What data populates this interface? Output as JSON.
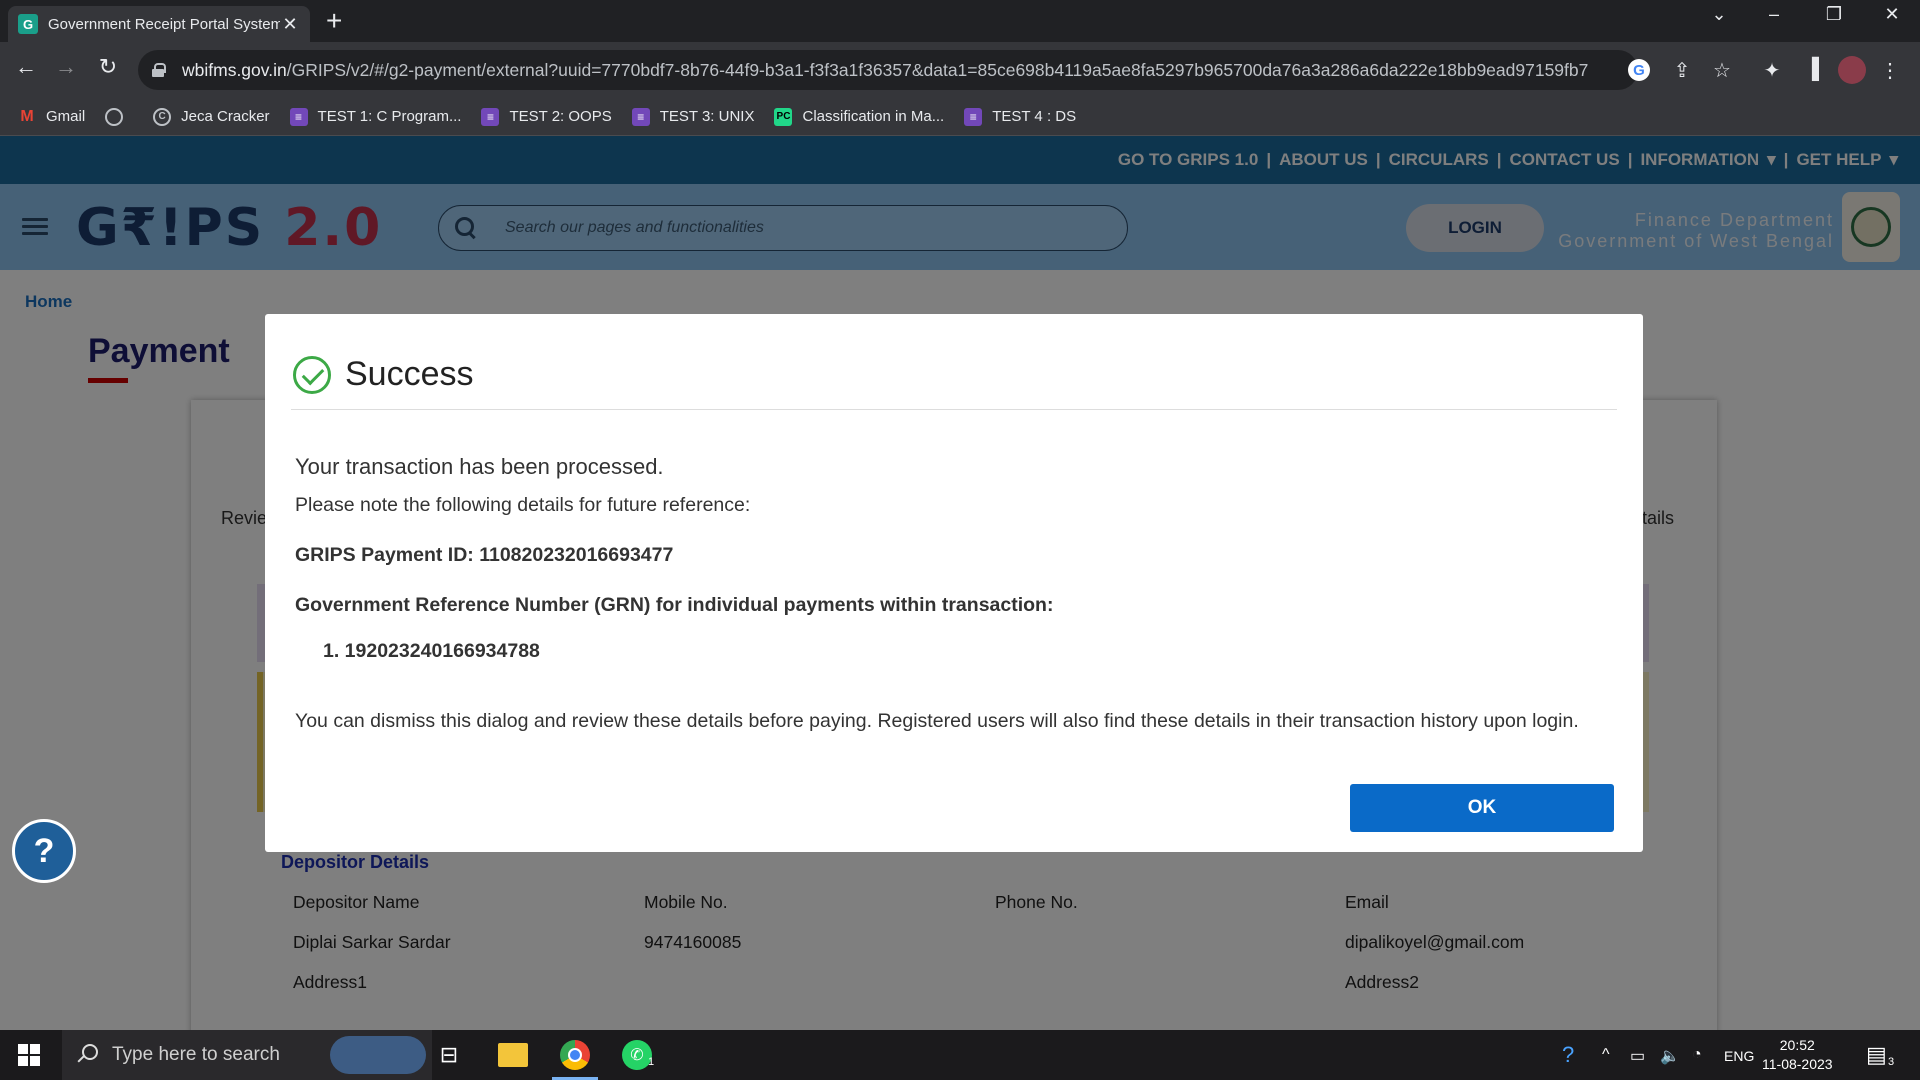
{
  "browser": {
    "tab_title": "Government Receipt Portal System",
    "tab_favicon": "G",
    "url_host": "wbifms.gov.in",
    "url_path": "/GRIPS/v2/#/g2-payment/external?uuid=7770bdf7-8b76-44f9-b3a1-f3f3a1f36357&data1=85ce698b4119a5ae8fa5297b965700da76a3a286a6da222e18bb9ead97159fb7",
    "bookmarks": [
      {
        "label": "Gmail",
        "icon": "gmail-icon"
      },
      {
        "label": "",
        "icon": "globe-icon"
      },
      {
        "label": "Jeca Cracker",
        "icon": "jeca-icon"
      },
      {
        "label": "TEST 1: C Program...",
        "icon": "forms-icon"
      },
      {
        "label": "TEST 2: OOPS",
        "icon": "forms-icon"
      },
      {
        "label": "TEST 3: UNIX",
        "icon": "forms-icon"
      },
      {
        "label": "Classification in Ma...",
        "icon": "pycharm-icon"
      },
      {
        "label": "TEST 4 : DS",
        "icon": "forms-icon"
      }
    ]
  },
  "site": {
    "topnav": [
      "GO TO GRIPS 1.0",
      "ABOUT US",
      "CIRCULARS",
      "CONTACT US",
      "INFORMATION",
      "GET HELP"
    ],
    "logo_main": "G₹!PS",
    "logo_version": "2.0",
    "search_placeholder": "Search our pages and functionalities",
    "login_label": "LOGIN",
    "dept_line1": "Finance Department",
    "dept_line2": "Government of West Bengal",
    "breadcrumb": "Home",
    "page_title": "Payment",
    "review_left": "Revie",
    "review_right": "etails",
    "depositor": {
      "title": "Depositor Details",
      "name_label": "Depositor Name",
      "name_value": "Diplai Sarkar Sardar",
      "mobile_label": "Mobile No.",
      "mobile_value": "9474160085",
      "phone_label": "Phone No.",
      "email_label": "Email",
      "email_value": "dipalikoyel@gmail.com",
      "address1_label": "Address1",
      "address2_label": "Address2"
    }
  },
  "modal": {
    "title": "Success",
    "processed": "Your transaction has been processed.",
    "note": "Please note the following details for future reference:",
    "payment_id": "GRIPS Payment ID: 110820232016693477",
    "grn_heading": "Government Reference Number (GRN) for individual payments within transaction:",
    "grn_items": [
      "1. 192023240166934788"
    ],
    "dismiss": "You can dismiss this dialog and review these details before paying. Registered users will also find these details in their transaction history upon login.",
    "ok_label": "OK"
  },
  "taskbar": {
    "search_placeholder": "Type here to search",
    "language": "ENG",
    "time": "20:52",
    "date": "11-08-2023",
    "whatsapp_badge": "1",
    "notification_count": "3"
  }
}
